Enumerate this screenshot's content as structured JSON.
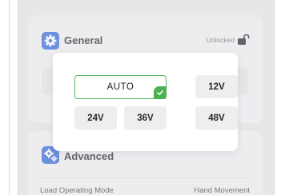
{
  "sections": {
    "general": {
      "title": "General",
      "icon": "gear-icon"
    },
    "advanced": {
      "title": "Advanced",
      "icon": "gears-icon"
    }
  },
  "lock": {
    "status": "Unlocked",
    "icon": "unlocked-padlock-icon"
  },
  "advanced_rows": [
    {
      "label": "Load Operating Mode",
      "value": "Hand Movement"
    }
  ],
  "voltage_picker": {
    "selected": "AUTO",
    "options": [
      "AUTO",
      "12V",
      "24V",
      "36V",
      "48V"
    ],
    "selected_badge_icon": "checkmark-icon"
  },
  "colors": {
    "accent": "#2d63d9",
    "selected_border": "#55b35a",
    "check_badge": "#4caf50",
    "panel_bg": "#e8e8ea",
    "option_bg": "#eeeef0"
  }
}
